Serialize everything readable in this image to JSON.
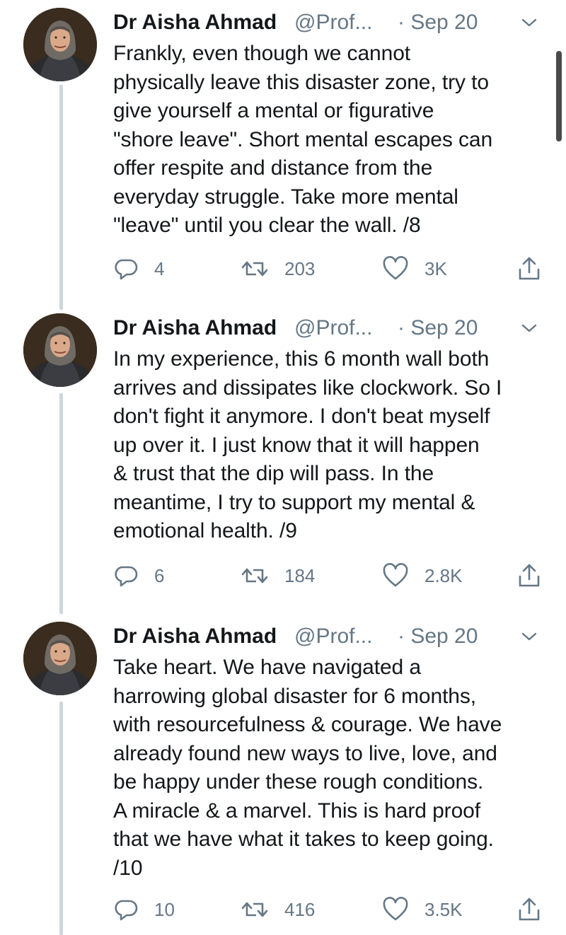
{
  "tweets": [
    {
      "author": "Dr Aisha Ahmad",
      "handle": "@Prof...",
      "date": "· Sep 20",
      "text": "Frankly, even though we cannot\nphysically leave this disaster zone, try to\ngive yourself a mental or figurative\n\"shore leave\". Short mental escapes can\noffer respite and distance from the\neveryday struggle. Take more mental\n\"leave\" until you clear the wall. /8",
      "replies": "4",
      "retweets": "203",
      "likes": "3K"
    },
    {
      "author": "Dr Aisha Ahmad",
      "handle": "@Prof...",
      "date": "· Sep 20",
      "text": "In my experience, this 6 month wall both\narrives and dissipates like clockwork. So I\ndon't fight it anymore. I don't beat myself\nup over it. I just know that it will happen\n& trust that the dip will pass. In the\nmeantime, I try to support my mental &\nemotional health. /9",
      "replies": "6",
      "retweets": "184",
      "likes": "2.8K"
    },
    {
      "author": "Dr Aisha Ahmad",
      "handle": "@Prof...",
      "date": "· Sep 20",
      "text": "Take heart. We have navigated a\nharrowing global disaster for 6 months,\nwith resourcefulness & courage. We have\nalready found new ways to live, love, and\nbe happy under these rough conditions.\nA miracle & a marvel. This is hard proof\nthat we have what it takes to keep going.\n/10",
      "replies": "10",
      "retweets": "416",
      "likes": "3.5K"
    }
  ],
  "colors": {
    "text": "#14171a",
    "secondary": "#657786",
    "thread_line": "#ccd6dd",
    "icon": "#657786"
  },
  "icons": {
    "reply": "reply-icon",
    "retweet": "retweet-icon",
    "like": "heart-icon",
    "share": "share-icon",
    "menu": "chevron-down-icon"
  }
}
